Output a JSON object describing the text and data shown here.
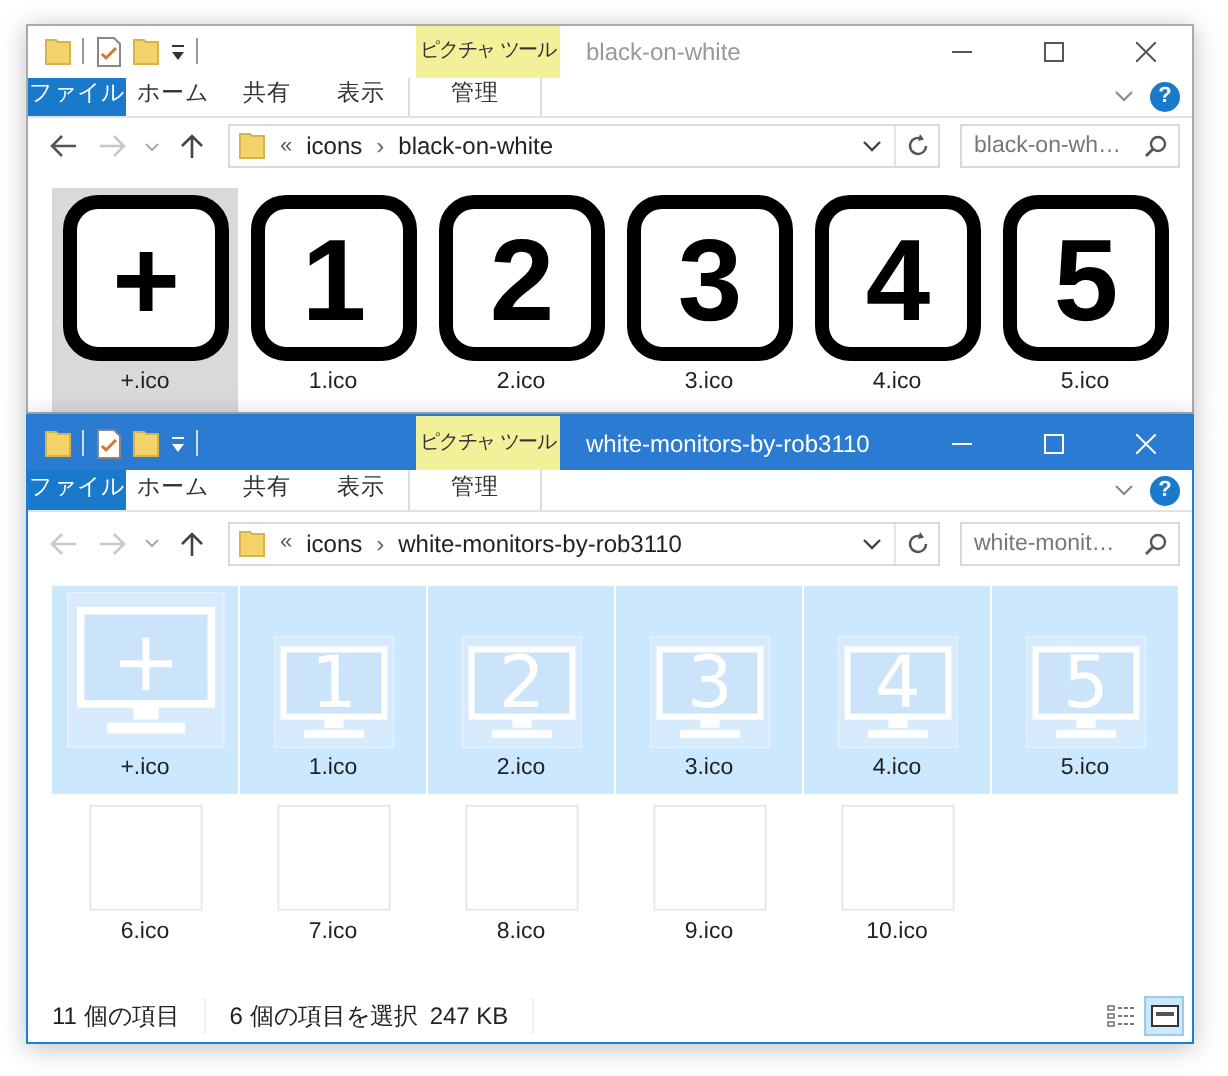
{
  "windows": [
    {
      "active": false,
      "context_tab": "ピクチャ ツール",
      "title": "black-on-white",
      "ribbon_tabs": [
        {
          "label": "ファイル",
          "kind": "file"
        },
        {
          "label": "ホーム",
          "kind": "tab"
        },
        {
          "label": "共有",
          "kind": "tab"
        },
        {
          "label": "表示",
          "kind": "tab"
        },
        {
          "label": "管理",
          "kind": "context"
        }
      ],
      "help": "?",
      "back_disabled": false,
      "address": [
        {
          "kind": "overflow",
          "text": "«"
        },
        {
          "kind": "crumb",
          "text": "icons"
        },
        {
          "kind": "separator",
          "text": "›"
        },
        {
          "kind": "crumb",
          "text": "black-on-white"
        }
      ],
      "search": {
        "placeholder": "black-on-wh…"
      },
      "items": [
        {
          "name": "+.ico",
          "kind": "square",
          "glyph": "+",
          "selected": true
        },
        {
          "name": "1.ico",
          "kind": "square",
          "glyph": "1",
          "selected": false
        },
        {
          "name": "2.ico",
          "kind": "square",
          "glyph": "2",
          "selected": false
        },
        {
          "name": "3.ico",
          "kind": "square",
          "glyph": "3",
          "selected": false
        },
        {
          "name": "4.ico",
          "kind": "square",
          "glyph": "4",
          "selected": false
        },
        {
          "name": "5.ico",
          "kind": "square",
          "glyph": "5",
          "selected": false
        }
      ]
    },
    {
      "active": true,
      "context_tab": "ピクチャ ツール",
      "title": "white-monitors-by-rob3110",
      "ribbon_tabs": [
        {
          "label": "ファイル",
          "kind": "file"
        },
        {
          "label": "ホーム",
          "kind": "tab"
        },
        {
          "label": "共有",
          "kind": "tab"
        },
        {
          "label": "表示",
          "kind": "tab"
        },
        {
          "label": "管理",
          "kind": "context"
        }
      ],
      "help": "?",
      "back_disabled": true,
      "address": [
        {
          "kind": "overflow",
          "text": "«"
        },
        {
          "kind": "crumb",
          "text": "icons"
        },
        {
          "kind": "separator",
          "text": "›"
        },
        {
          "kind": "crumb",
          "text": "white-monitors-by-rob3110"
        }
      ],
      "search": {
        "placeholder": "white-monit…"
      },
      "items": [
        {
          "name": "+.ico",
          "kind": "bigmonitor",
          "glyph": "+",
          "selected": true
        },
        {
          "name": "1.ico",
          "kind": "monitor",
          "glyph": "1",
          "selected": true
        },
        {
          "name": "2.ico",
          "kind": "monitor",
          "glyph": "2",
          "selected": true
        },
        {
          "name": "3.ico",
          "kind": "monitor",
          "glyph": "3",
          "selected": true
        },
        {
          "name": "4.ico",
          "kind": "monitor",
          "glyph": "4",
          "selected": true
        },
        {
          "name": "5.ico",
          "kind": "monitor",
          "glyph": "5",
          "selected": true
        },
        {
          "name": "6.ico",
          "kind": "blank",
          "selected": false
        },
        {
          "name": "7.ico",
          "kind": "blank",
          "selected": false
        },
        {
          "name": "8.ico",
          "kind": "blank",
          "selected": false
        },
        {
          "name": "9.ico",
          "kind": "blank",
          "selected": false
        },
        {
          "name": "10.ico",
          "kind": "blank",
          "selected": false
        }
      ],
      "status_bar": {
        "count": "11 個の項目",
        "selection": "6 個の項目を選択",
        "size": "247 KB",
        "views": [
          {
            "kind": "details",
            "selected": false
          },
          {
            "kind": "large-icons",
            "selected": true
          }
        ]
      }
    }
  ]
}
